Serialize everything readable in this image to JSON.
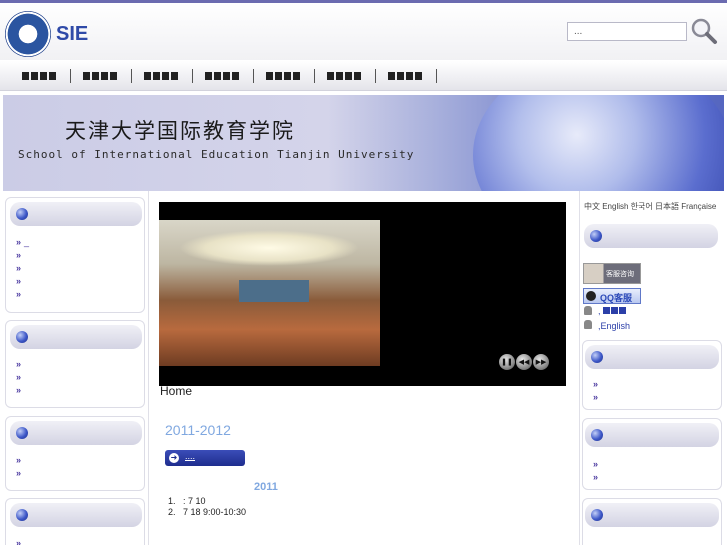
{
  "header": {
    "logo_text": "SIE",
    "search": {
      "value": "...",
      "placeholder": "..."
    }
  },
  "nav": {
    "items": [
      "",
      "",
      "",
      "",
      "",
      "",
      ""
    ]
  },
  "banner": {
    "title_cn": "天津大学国际教育学院",
    "title_en": "School of International Education Tianjin University"
  },
  "left_panels": [
    {
      "items": [
        "_",
        "",
        "",
        "",
        ""
      ]
    },
    {
      "items": [
        "",
        "",
        ""
      ]
    },
    {
      "items": [
        "",
        ""
      ]
    },
    {
      "items": [
        ""
      ]
    }
  ],
  "slideshow": {
    "controls": [
      "pause",
      "prev",
      "next"
    ]
  },
  "main": {
    "home_label": "Home",
    "year_heading": "2011-2012",
    "more_button": "....",
    "sub_year": "2011",
    "ol_items": [
      "1.   : 7 10",
      "2.   7 18 9:00-10:30"
    ]
  },
  "right": {
    "lang_links": "中文 English 한국어 日本語 Française",
    "service_text": "客服咨询",
    "qq_text": "QQ客服",
    "contact_1": ",",
    "contact_2": ",English",
    "panels": [
      {
        "items": []
      },
      {
        "items": [
          "",
          ""
        ]
      },
      {
        "items": [
          "",
          ""
        ]
      },
      {
        "items": []
      }
    ]
  },
  "colors": {
    "accent": "#3a3a9a",
    "link": "#4b3aa0",
    "heading_blue": "#80a8e0"
  },
  "icons": {
    "search": "magnifier-icon",
    "bullet": "blue-orb-icon",
    "user": "user-icon"
  }
}
